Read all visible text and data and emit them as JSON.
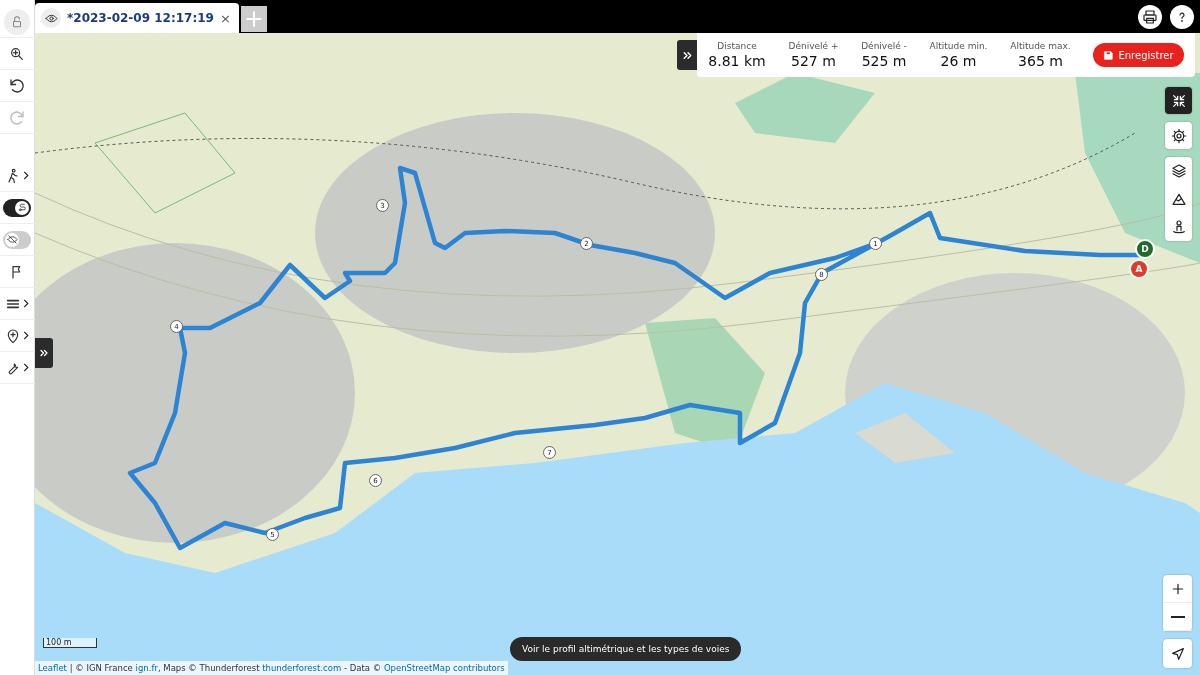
{
  "tab": {
    "title": "*2023-02-09 12:17:19",
    "close": "×",
    "selected": true
  },
  "toolbar": {
    "redo_disabled": true,
    "toggles": [
      {
        "on": true
      },
      {
        "on": false
      }
    ]
  },
  "stats": [
    {
      "label": "Distance",
      "value": "8.81 km"
    },
    {
      "label": "Dénivelé +",
      "value": "527 m"
    },
    {
      "label": "Dénivelé -",
      "value": "525 m"
    },
    {
      "label": "Altitude min.",
      "value": "26 m"
    },
    {
      "label": "Altitude max.",
      "value": "365 m"
    }
  ],
  "save_button": "Enregistrer",
  "markers": [
    {
      "label": "1",
      "kind": "waypoint"
    },
    {
      "label": "2",
      "kind": "waypoint"
    },
    {
      "label": "3",
      "kind": "waypoint"
    },
    {
      "label": "4",
      "kind": "waypoint"
    },
    {
      "label": "5",
      "kind": "waypoint"
    },
    {
      "label": "6",
      "kind": "waypoint"
    },
    {
      "label": "7",
      "kind": "waypoint"
    },
    {
      "label": "8",
      "kind": "waypoint"
    },
    {
      "label": "D",
      "kind": "start"
    },
    {
      "label": "A",
      "kind": "end"
    }
  ],
  "scale": "100 m",
  "profile_button": "Voir le profil altimétrique et les types de voies",
  "attribution": [
    {
      "text": "Leaflet",
      "link": true
    },
    {
      "text": " | © IGN France ",
      "link": false
    },
    {
      "text": "ign.fr",
      "link": true
    },
    {
      "text": ", Maps © Thunderforest ",
      "link": false
    },
    {
      "text": "thunderforest.com",
      "link": true
    },
    {
      "text": " - Data © ",
      "link": false
    },
    {
      "text": "OpenStreetMap contributors",
      "link": true
    }
  ]
}
